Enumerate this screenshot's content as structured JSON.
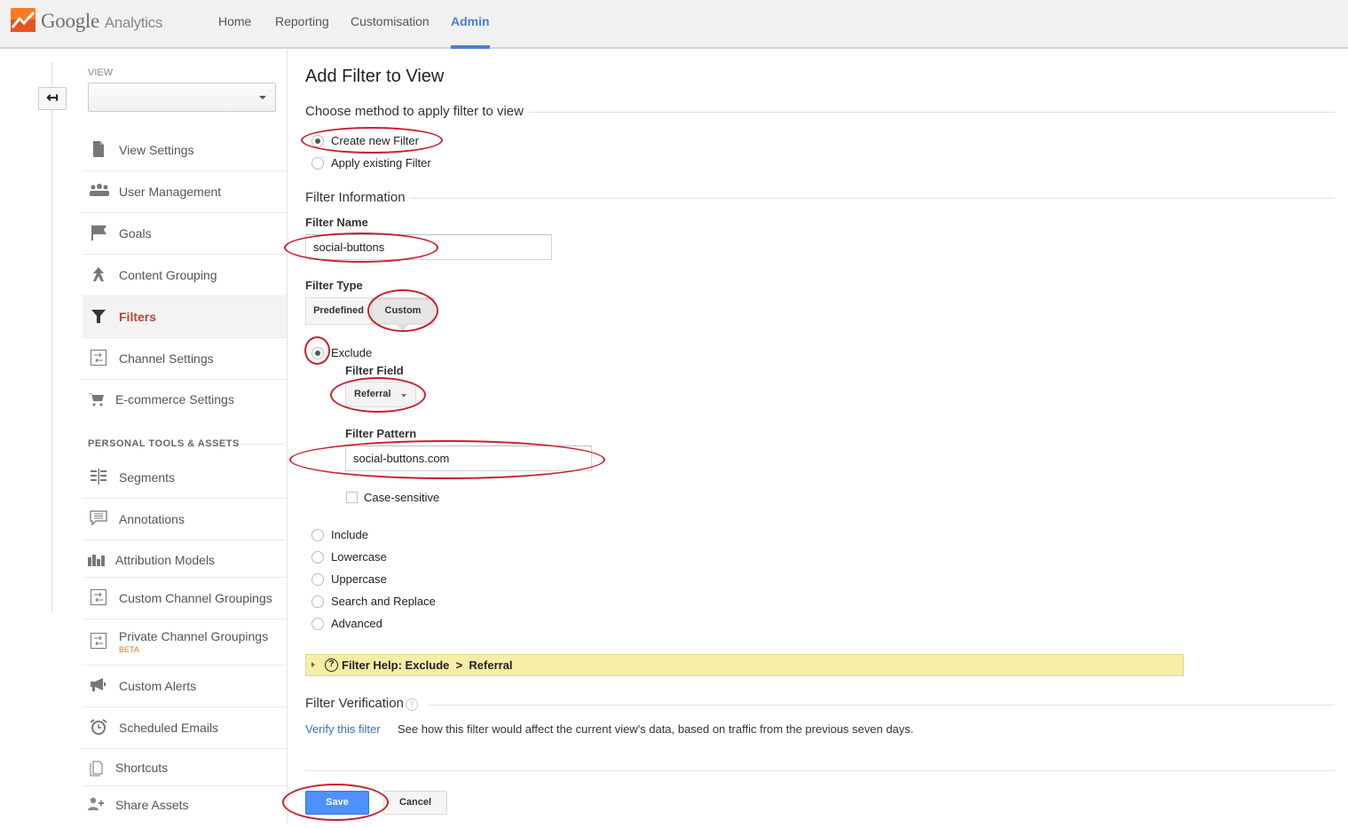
{
  "app": {
    "brand_google": "Google",
    "brand_product": "Analytics",
    "nav": [
      {
        "label": "Home",
        "active": false
      },
      {
        "label": "Reporting",
        "active": false
      },
      {
        "label": "Customisation",
        "active": false
      },
      {
        "label": "Admin",
        "active": true
      }
    ],
    "accent_color": "#4d7ed6"
  },
  "sidebar": {
    "back_icon": "back-arrow-icon",
    "view_label": "VIEW",
    "view_selected": "",
    "items": [
      {
        "label": "View Settings",
        "icon": "document-icon"
      },
      {
        "label": "User Management",
        "icon": "users-icon"
      },
      {
        "label": "Goals",
        "icon": "flag-icon"
      },
      {
        "label": "Content Grouping",
        "icon": "merge-icon"
      },
      {
        "label": "Filters",
        "icon": "funnel-icon",
        "active": true
      },
      {
        "label": "Channel Settings",
        "icon": "channel-icon"
      },
      {
        "label": "E-commerce Settings",
        "icon": "cart-icon"
      }
    ],
    "section_header": "PERSONAL TOOLS & ASSETS",
    "tools": [
      {
        "label": "Segments",
        "icon": "segments-icon"
      },
      {
        "label": "Annotations",
        "icon": "speech-bubble-icon"
      },
      {
        "label": "Attribution Models",
        "icon": "bar-chart-icon"
      },
      {
        "label": "Custom Channel Groupings",
        "icon": "channel-icon"
      },
      {
        "label": "Private Channel Groupings",
        "icon": "channel-icon",
        "badge": "BETA"
      },
      {
        "label": "Custom Alerts",
        "icon": "megaphone-icon"
      },
      {
        "label": "Scheduled Emails",
        "icon": "alarm-clock-icon"
      },
      {
        "label": "Shortcuts",
        "icon": "pages-icon"
      },
      {
        "label": "Share Assets",
        "icon": "add-user-icon"
      }
    ]
  },
  "form": {
    "title": "Add Filter to View",
    "method_legend": "Choose method to apply filter to view",
    "method_options": [
      {
        "label": "Create new Filter",
        "selected": true
      },
      {
        "label": "Apply existing Filter",
        "selected": false
      }
    ],
    "info_legend": "Filter Information",
    "filter_name_label": "Filter Name",
    "filter_name_value": "social-buttons",
    "filter_type_label": "Filter Type",
    "filter_type_tabs": [
      {
        "label": "Predefined",
        "selected": false
      },
      {
        "label": "Custom",
        "selected": true
      }
    ],
    "custom_options": [
      {
        "label": "Exclude",
        "selected": true
      },
      {
        "label": "Include",
        "selected": false
      },
      {
        "label": "Lowercase",
        "selected": false
      },
      {
        "label": "Uppercase",
        "selected": false
      },
      {
        "label": "Search and Replace",
        "selected": false
      },
      {
        "label": "Advanced",
        "selected": false
      }
    ],
    "filter_field_label": "Filter Field",
    "filter_field_value": "Referral",
    "filter_pattern_label": "Filter Pattern",
    "filter_pattern_value": "social-buttons.com",
    "case_sensitive_label": "Case-sensitive",
    "case_sensitive_checked": false,
    "help_bar_text": "Filter Help: Exclude  >  Referral",
    "verification_legend": "Filter Verification",
    "verify_link": "Verify this filter",
    "verify_description": "See how this filter would affect the current view's data, based on traffic from the previous seven days.",
    "save_label": "Save",
    "cancel_label": "Cancel"
  },
  "annotation_color": "#c8202c"
}
